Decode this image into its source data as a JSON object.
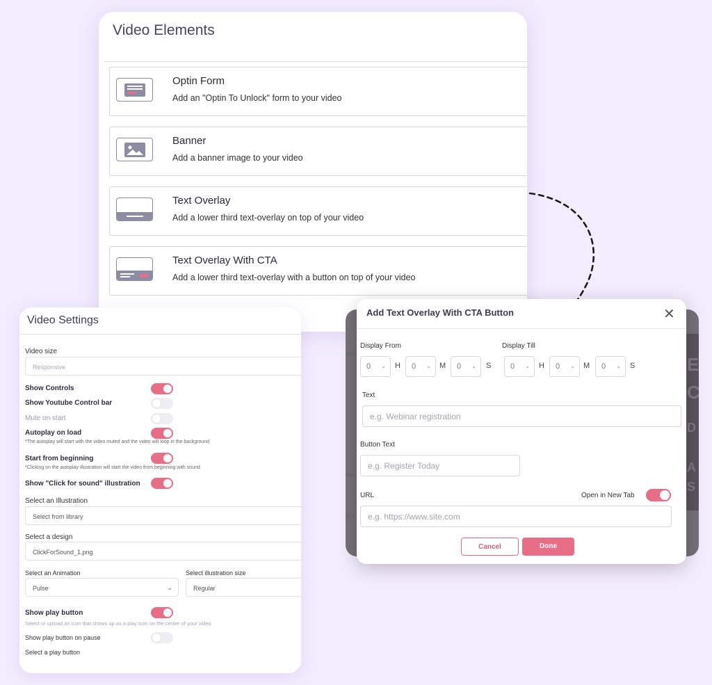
{
  "video_elements": {
    "title": "Video Elements",
    "items": [
      {
        "name": "Optin Form",
        "desc": "Add an \"Optin To Unlock\" form to your video",
        "icon": "optin-form-icon"
      },
      {
        "name": "Banner",
        "desc": "Add a banner image to your video",
        "icon": "banner-image-icon"
      },
      {
        "name": "Text Overlay",
        "desc": "Add a lower third text-overlay on top of your video",
        "icon": "text-overlay-icon"
      },
      {
        "name": "Text Overlay With CTA",
        "desc": "Add a lower third text-overlay with a button on top of your video",
        "icon": "text-overlay-cta-icon"
      }
    ]
  },
  "video_settings": {
    "title": "Video Settings",
    "video_size_label": "Video size",
    "video_size_value": "Responsive",
    "show_controls": {
      "label": "Show Controls",
      "on": true
    },
    "show_youtube_bar": {
      "label": "Show Youtube Control bar",
      "on": false
    },
    "mute_on_start": {
      "label": "Mute on start",
      "on": false
    },
    "autoplay": {
      "label": "Autoplay on load",
      "on": true,
      "note": "*The autoplay will start with the video muted and the video will loop in the background"
    },
    "start_from_beginning": {
      "label": "Start from beginning",
      "on": true,
      "note": "*Clicking on the autoplay illustration will start the video from beginning with sound"
    },
    "show_click_for_sound": {
      "label": "Show \"Click for sound\" illustration",
      "on": true
    },
    "illustration_label": "Select an Illustration",
    "illustration_placeholder": "Select from library",
    "design_label": "Select a design",
    "design_value": "ClickForSound_1.png",
    "animation_label": "Select an Animation",
    "animation_value": "Pulse",
    "size_label": "Select illustration size",
    "size_value": "Regular",
    "show_play_button": {
      "label": "Show play button",
      "on": true,
      "note": "Select or upload an icon that shows up as a play icon on the center of your video"
    },
    "show_play_on_pause": {
      "label": "Show play button on pause",
      "on": false
    },
    "select_play_button_label": "Select a play button"
  },
  "modal": {
    "title": "Add Text Overlay With CTA Button",
    "close_glyph": "✕",
    "display_from_label": "Display From",
    "display_till_label": "Display Till",
    "from": {
      "h": "0",
      "m": "0",
      "s": "0"
    },
    "till": {
      "h": "0",
      "m": "0",
      "s": "0"
    },
    "unit_h": "H",
    "unit_m": "M",
    "unit_s": "S",
    "text_label": "Text",
    "text_placeholder": "e.g. Webinar registration",
    "button_text_label": "Button Text",
    "button_text_placeholder": "e.g. Register Today",
    "url_label": "URL",
    "url_placeholder": "e.g. https://www.site.com",
    "open_new_tab": {
      "label": "Open in New Tab",
      "on": true
    },
    "cancel_label": "Cancel",
    "done_label": "Done"
  },
  "background_fragments": {
    "left": [
      "you",
      "mp",
      "h's a"
    ],
    "right": [
      "E",
      "C",
      "D",
      "A",
      "S"
    ]
  },
  "colors": {
    "accent": "#e86e86",
    "background": "#f3ecfd",
    "icon_fill": "#8c8ca4",
    "dark_backdrop": "#767079"
  }
}
